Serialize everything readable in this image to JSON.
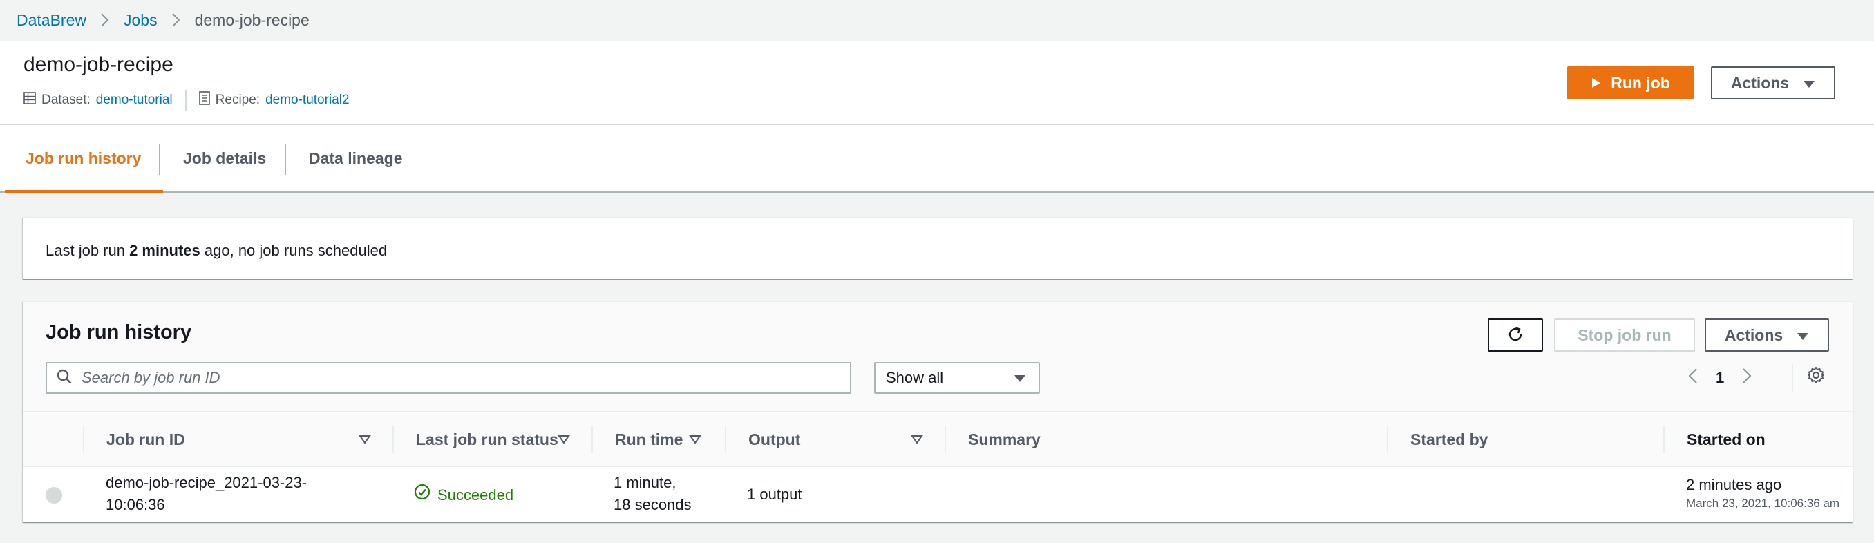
{
  "breadcrumb": [
    "DataBrew",
    "Jobs",
    "demo-job-recipe"
  ],
  "header": {
    "title": "demo-job-recipe",
    "dataset_label": "Dataset:",
    "dataset_value": "demo-tutorial",
    "recipe_label": "Recipe:",
    "recipe_value": "demo-tutorial2",
    "run_label": "Run job",
    "actions_label": "Actions"
  },
  "tabs": [
    "Job run history",
    "Job details",
    "Data lineage"
  ],
  "status": {
    "prefix": "Last job run ",
    "bold": "2 minutes",
    "suffix": " ago, no job runs scheduled"
  },
  "table": {
    "heading": "Job run history",
    "stop_label": "Stop job run",
    "actions_label": "Actions",
    "search_placeholder": "Search by job run ID",
    "filter_value": "Show all",
    "page": "1",
    "columns": [
      "Job run ID",
      "Last job run status",
      "Run time",
      "Output",
      "Summary",
      "Started by",
      "Started on"
    ],
    "rows": [
      {
        "id_line1": "demo-job-recipe_2021-03-23-",
        "id_line2": "10:06:36",
        "status": "Succeeded",
        "runtime_line1": "1 minute,",
        "runtime_line2": "18 seconds",
        "output": "1 output",
        "summary": "",
        "started_by": "",
        "started_on": "2 minutes ago",
        "started_on_detail": "March 23, 2021, 10:06:36 am"
      }
    ]
  },
  "colors": {
    "accent": "#ec7211",
    "link": "#0073bb",
    "success": "#1d8102"
  }
}
